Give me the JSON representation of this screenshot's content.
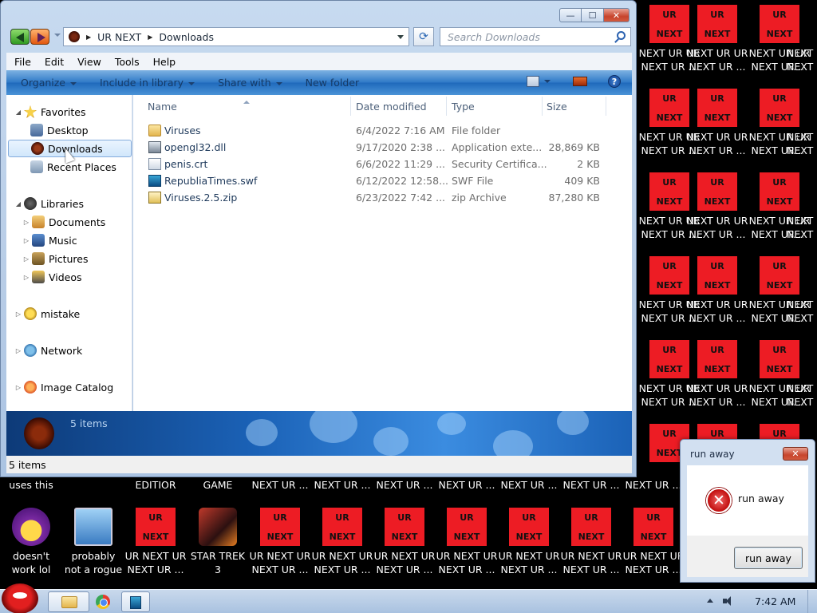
{
  "desktop": {
    "ur_icon": {
      "top_text": "UR",
      "bottom_text": "NEXT",
      "label_line1": "NEXT UR UR",
      "label_line2": "NEXT UR ..."
    },
    "ur_icon_right": {
      "top_text": "UR",
      "bottom_text": "NEXT",
      "label_line1": "NEXT UR U",
      "label_line2": "NEXT UR"
    },
    "bottom_row_top_labels": [
      "uses this",
      "EDITIOR",
      "GAME",
      "NEXT UR ...",
      "NEXT UR ...",
      "NEXT UR ...",
      "NEXT UR ...",
      "NEXT UR ...",
      "NEXT UR ...",
      "NEXT UR ..."
    ],
    "yahoo_icon": {
      "label_line1": "doesn't",
      "label_line2": "work lol"
    },
    "rogue_icon": {
      "label_line1": "probably",
      "label_line2": "not a rogue"
    },
    "ur_bottom_icon": {
      "top_text": "UR",
      "bottom_text": "NEXT",
      "label_line1": "UR NEXT UR",
      "label_line2": "NEXT UR ..."
    },
    "startrek_icon": {
      "label_line1": "STAR TREK",
      "label_line2": "3"
    }
  },
  "explorer": {
    "caption": {
      "minimize": "—",
      "maximize": "☐",
      "close": "✕"
    },
    "address": {
      "crumbs": [
        "UR NEXT",
        "Downloads"
      ]
    },
    "search": {
      "placeholder": "Search Downloads"
    },
    "menu": [
      "File",
      "Edit",
      "View",
      "Tools",
      "Help"
    ],
    "commands": [
      "Organize",
      "Include in library",
      "Share with",
      "New folder"
    ],
    "help": "?",
    "nav": {
      "favorites": "Favorites",
      "desktop": "Desktop",
      "downloads": "Downloads",
      "recent": "Recent Places",
      "libraries": "Libraries",
      "documents": "Documents",
      "music": "Music",
      "pictures": "Pictures",
      "videos": "Videos",
      "mistake": "mistake",
      "network": "Network",
      "image_catalog": "Image Catalog"
    },
    "columns": {
      "name": "Name",
      "date": "Date modified",
      "type": "Type",
      "size": "Size"
    },
    "files": [
      {
        "name": "Viruses",
        "date": "6/4/2022 7:16 AM",
        "type": "File folder",
        "size": "",
        "icon": "folder-icon"
      },
      {
        "name": "opengl32.dll",
        "date": "9/17/2020 2:38 ...",
        "type": "Application exte...",
        "size": "28,869 KB",
        "icon": "dll-file-icon"
      },
      {
        "name": "penis.crt",
        "date": "6/6/2022 11:29 ...",
        "type": "Security Certifica...",
        "size": "2 KB",
        "icon": "certificate-file-icon"
      },
      {
        "name": "RepubliaTimes.swf",
        "date": "6/12/2022 12:58...",
        "type": "SWF File",
        "size": "409 KB",
        "icon": "swf-file-icon"
      },
      {
        "name": "Viruses.2.5.zip",
        "date": "6/23/2022 7:42 ...",
        "type": "zip Archive",
        "size": "87,280 KB",
        "icon": "zip-file-icon"
      }
    ],
    "details_text": "5 items",
    "status_text": "5 items"
  },
  "dialog": {
    "title": "run away",
    "close": "✕",
    "message": "run away",
    "button": "run away",
    "error_glyph": "✕"
  },
  "taskbar": {
    "clock": "7:42 AM"
  }
}
